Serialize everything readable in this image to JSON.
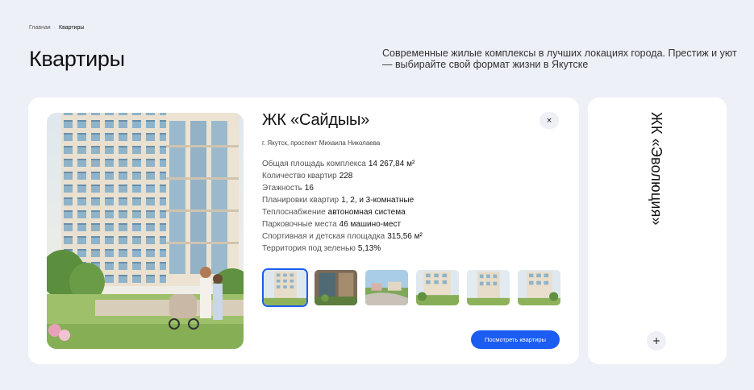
{
  "breadcrumb": {
    "home": "Главная",
    "separator": "·",
    "current": "Квартиры"
  },
  "page": {
    "title": "Квартиры",
    "intro": "Современные жилые комплексы в лучших локациях города. Престиж и уют — выбирайте свой формат жизни в Якутске"
  },
  "complex": {
    "name": "ЖК «Сайдыы»",
    "address": "г. Якутск, проспект Михаила Николаева",
    "close_icon": "×",
    "specs": [
      {
        "label": "Общая площадь комплекса",
        "value": "14 267,84 м²"
      },
      {
        "label": "Количество квартир",
        "value": "228"
      },
      {
        "label": "Этажность",
        "value": "16"
      },
      {
        "label": "Планировки квартир",
        "value": "1, 2, и 3-комнатные"
      },
      {
        "label": "Теплоснабжение",
        "value": "автономная система"
      },
      {
        "label": "Парковочные места",
        "value": "46 машино-мест"
      },
      {
        "label": "Спортивная и детская площадка",
        "value": "315,56 м²"
      },
      {
        "label": "Территория под зеленью",
        "value": "5,13%"
      }
    ],
    "cta_label": "Посмотреть квартиры"
  },
  "side_complex": {
    "name": "ЖК «Эволюция»",
    "plus_icon": "+"
  },
  "colors": {
    "accent": "#1b5cf2",
    "background": "#eef0f8"
  }
}
